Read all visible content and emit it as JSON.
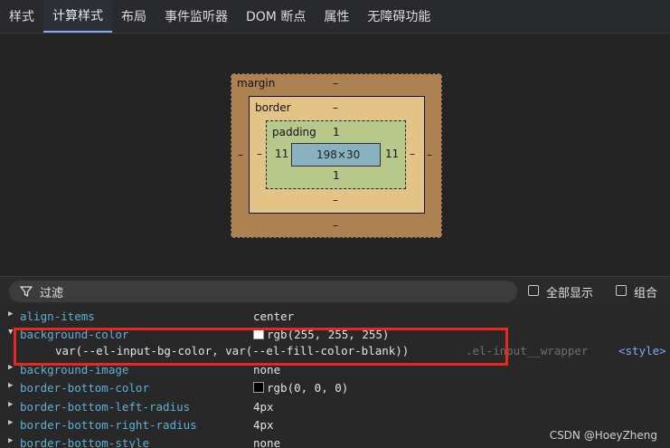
{
  "tabs": [
    "样式",
    "计算样式",
    "布局",
    "事件监听器",
    "DOM 断点",
    "属性",
    "无障碍功能"
  ],
  "box_model": {
    "margin": {
      "label": "margin",
      "top": "–",
      "bottom": "–",
      "left": "–",
      "right": "–"
    },
    "border": {
      "label": "border",
      "top": "–",
      "bottom": "–",
      "left": "–",
      "right": "–"
    },
    "padding": {
      "label": "padding",
      "top": "1",
      "bottom": "1",
      "left": "11",
      "right": "11"
    },
    "content": "198×30"
  },
  "filter": {
    "placeholder": "过滤",
    "show_all": "全部显示",
    "group": "组合"
  },
  "properties": [
    {
      "name": "align-items",
      "value": "center"
    },
    {
      "name": "background-color",
      "value": "rgb(255, 255, 255)",
      "swatch": "#ffffff",
      "detail": "var(--el-input-bg-color, var(--el-fill-color-blank))",
      "selector": ".el-input__wrapper",
      "source": "<style>"
    },
    {
      "name": "background-image",
      "value": "none"
    },
    {
      "name": "border-bottom-color",
      "value": "rgb(0, 0, 0)",
      "swatch": "#000000"
    },
    {
      "name": "border-bottom-left-radius",
      "value": "4px"
    },
    {
      "name": "border-bottom-right-radius",
      "value": "4px"
    },
    {
      "name": "border-bottom-style",
      "value": "none"
    }
  ],
  "watermark": "CSDN @HoeyZheng"
}
